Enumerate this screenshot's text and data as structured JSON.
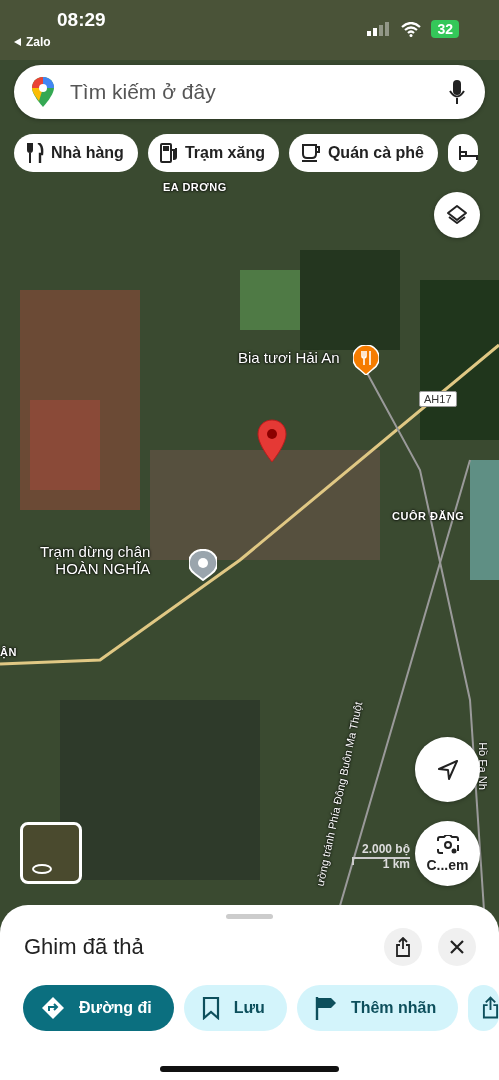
{
  "status_bar": {
    "time": "08:29",
    "back_app": "Zalo",
    "battery": "32"
  },
  "search": {
    "placeholder": "Tìm kiếm ở đây"
  },
  "category_chips": [
    {
      "label": "Nhà hàng",
      "kind": "restaurant"
    },
    {
      "label": "Trạm xăng",
      "kind": "gas"
    },
    {
      "label": "Quán cà phê",
      "kind": "cafe"
    }
  ],
  "map_labels": [
    {
      "text": "EA DRƠNG",
      "kind": "area"
    },
    {
      "text": "Bia tươi Hải An",
      "kind": "poi"
    },
    {
      "text": "AH17",
      "kind": "shield"
    },
    {
      "text": "CUÔR ĐĂNG",
      "kind": "area"
    },
    {
      "text": "Trạm dừng chân\nHOÀN NGHĨA",
      "kind": "stop"
    },
    {
      "text": "ẬN",
      "kind": "area"
    },
    {
      "text": "ường tránh Phía Đông Buôn Ma Thuột",
      "kind": "road"
    },
    {
      "text": "Hồ Ea Nh",
      "kind": "road"
    }
  ],
  "scale": {
    "imperial": "2.000 bộ",
    "metric": "1 km"
  },
  "lens_button": {
    "label": "C...em"
  },
  "sheet": {
    "title": "Ghim đã thả",
    "actions": [
      {
        "label": "Đường đi",
        "kind": "directions"
      },
      {
        "label": "Lưu",
        "kind": "save"
      },
      {
        "label": "Thêm nhãn",
        "kind": "label"
      }
    ]
  }
}
